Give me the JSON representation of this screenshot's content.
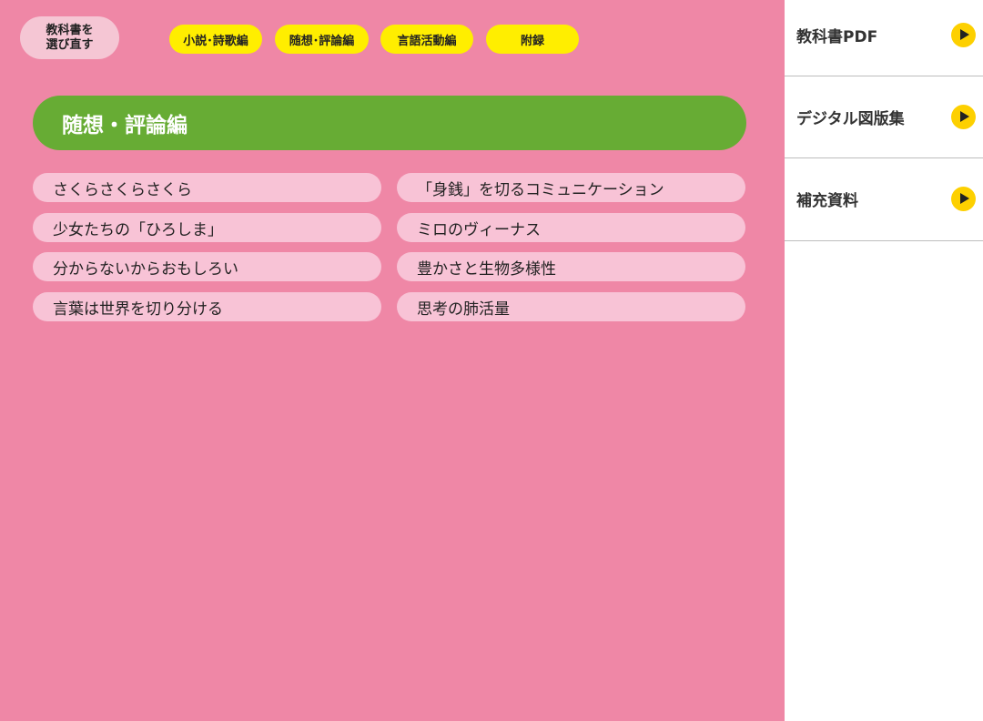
{
  "header": {
    "reselect_label": "教科書を\n選び直す",
    "tabs": [
      {
        "label": "小説･詩歌編"
      },
      {
        "label": "随想･評論編"
      },
      {
        "label": "言語活動編"
      },
      {
        "label": "附録"
      }
    ]
  },
  "section": {
    "title": "随想・評論編",
    "items_left": [
      {
        "label": "さくらさくらさくら"
      },
      {
        "label": "少女たちの「ひろしま」"
      },
      {
        "label": "分からないからおもしろい"
      },
      {
        "label": "言葉は世界を切り分ける"
      }
    ],
    "items_right": [
      {
        "label": "「身銭」を切るコミュニケーション"
      },
      {
        "label": "ミロのヴィーナス"
      },
      {
        "label": "豊かさと生物多様性"
      },
      {
        "label": "思考の肺活量"
      }
    ]
  },
  "sidebar": {
    "items": [
      {
        "label": "教科書PDF",
        "icon": "play-arrow-icon"
      },
      {
        "label": "デジタル図版集",
        "icon": "play-arrow-icon"
      },
      {
        "label": "補充資料",
        "icon": "play-arrow-icon"
      }
    ]
  },
  "colors": {
    "main_bg": "#ef87a6",
    "tab_bg": "#ffee00",
    "header_bg": "#67ac34",
    "item_bg": "#f8c3d6",
    "reselect_bg": "#f5c6d4",
    "arrow_bg": "#fdd000"
  }
}
